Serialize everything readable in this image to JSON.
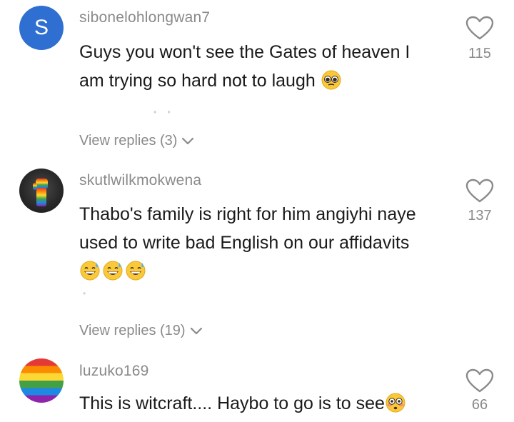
{
  "comments": [
    {
      "avatar_letter": "S",
      "username": "sibonelohlongwan7",
      "text_line1": "Guys you won't see the Gates of heaven I",
      "text_line2": "am trying so hard not to laugh",
      "likes": "115",
      "replies_label": "View replies (3)"
    },
    {
      "username": "skutlwilkmokwena",
      "text_line1": "Thabo's family is right for him angiyhi naye",
      "text_line2": "used to write bad English on our affidavits",
      "likes": "137",
      "replies_label": "View replies (19)"
    },
    {
      "username": "luzuko169",
      "text_line1": "This is witcraft.... Haybo to go is to see",
      "likes": "66"
    }
  ],
  "icons": {
    "heart": "heart-outline-icon",
    "chevron": "chevron-down-icon",
    "pleading": "pleading-face-emoji",
    "sweat": "grinning-sweat-emoji",
    "flushed": "flushed-face-emoji"
  },
  "colors": {
    "avatar_blue": "#2f6fd1",
    "muted_text": "#8a8a8a",
    "body_text": "#1a1a1a"
  }
}
